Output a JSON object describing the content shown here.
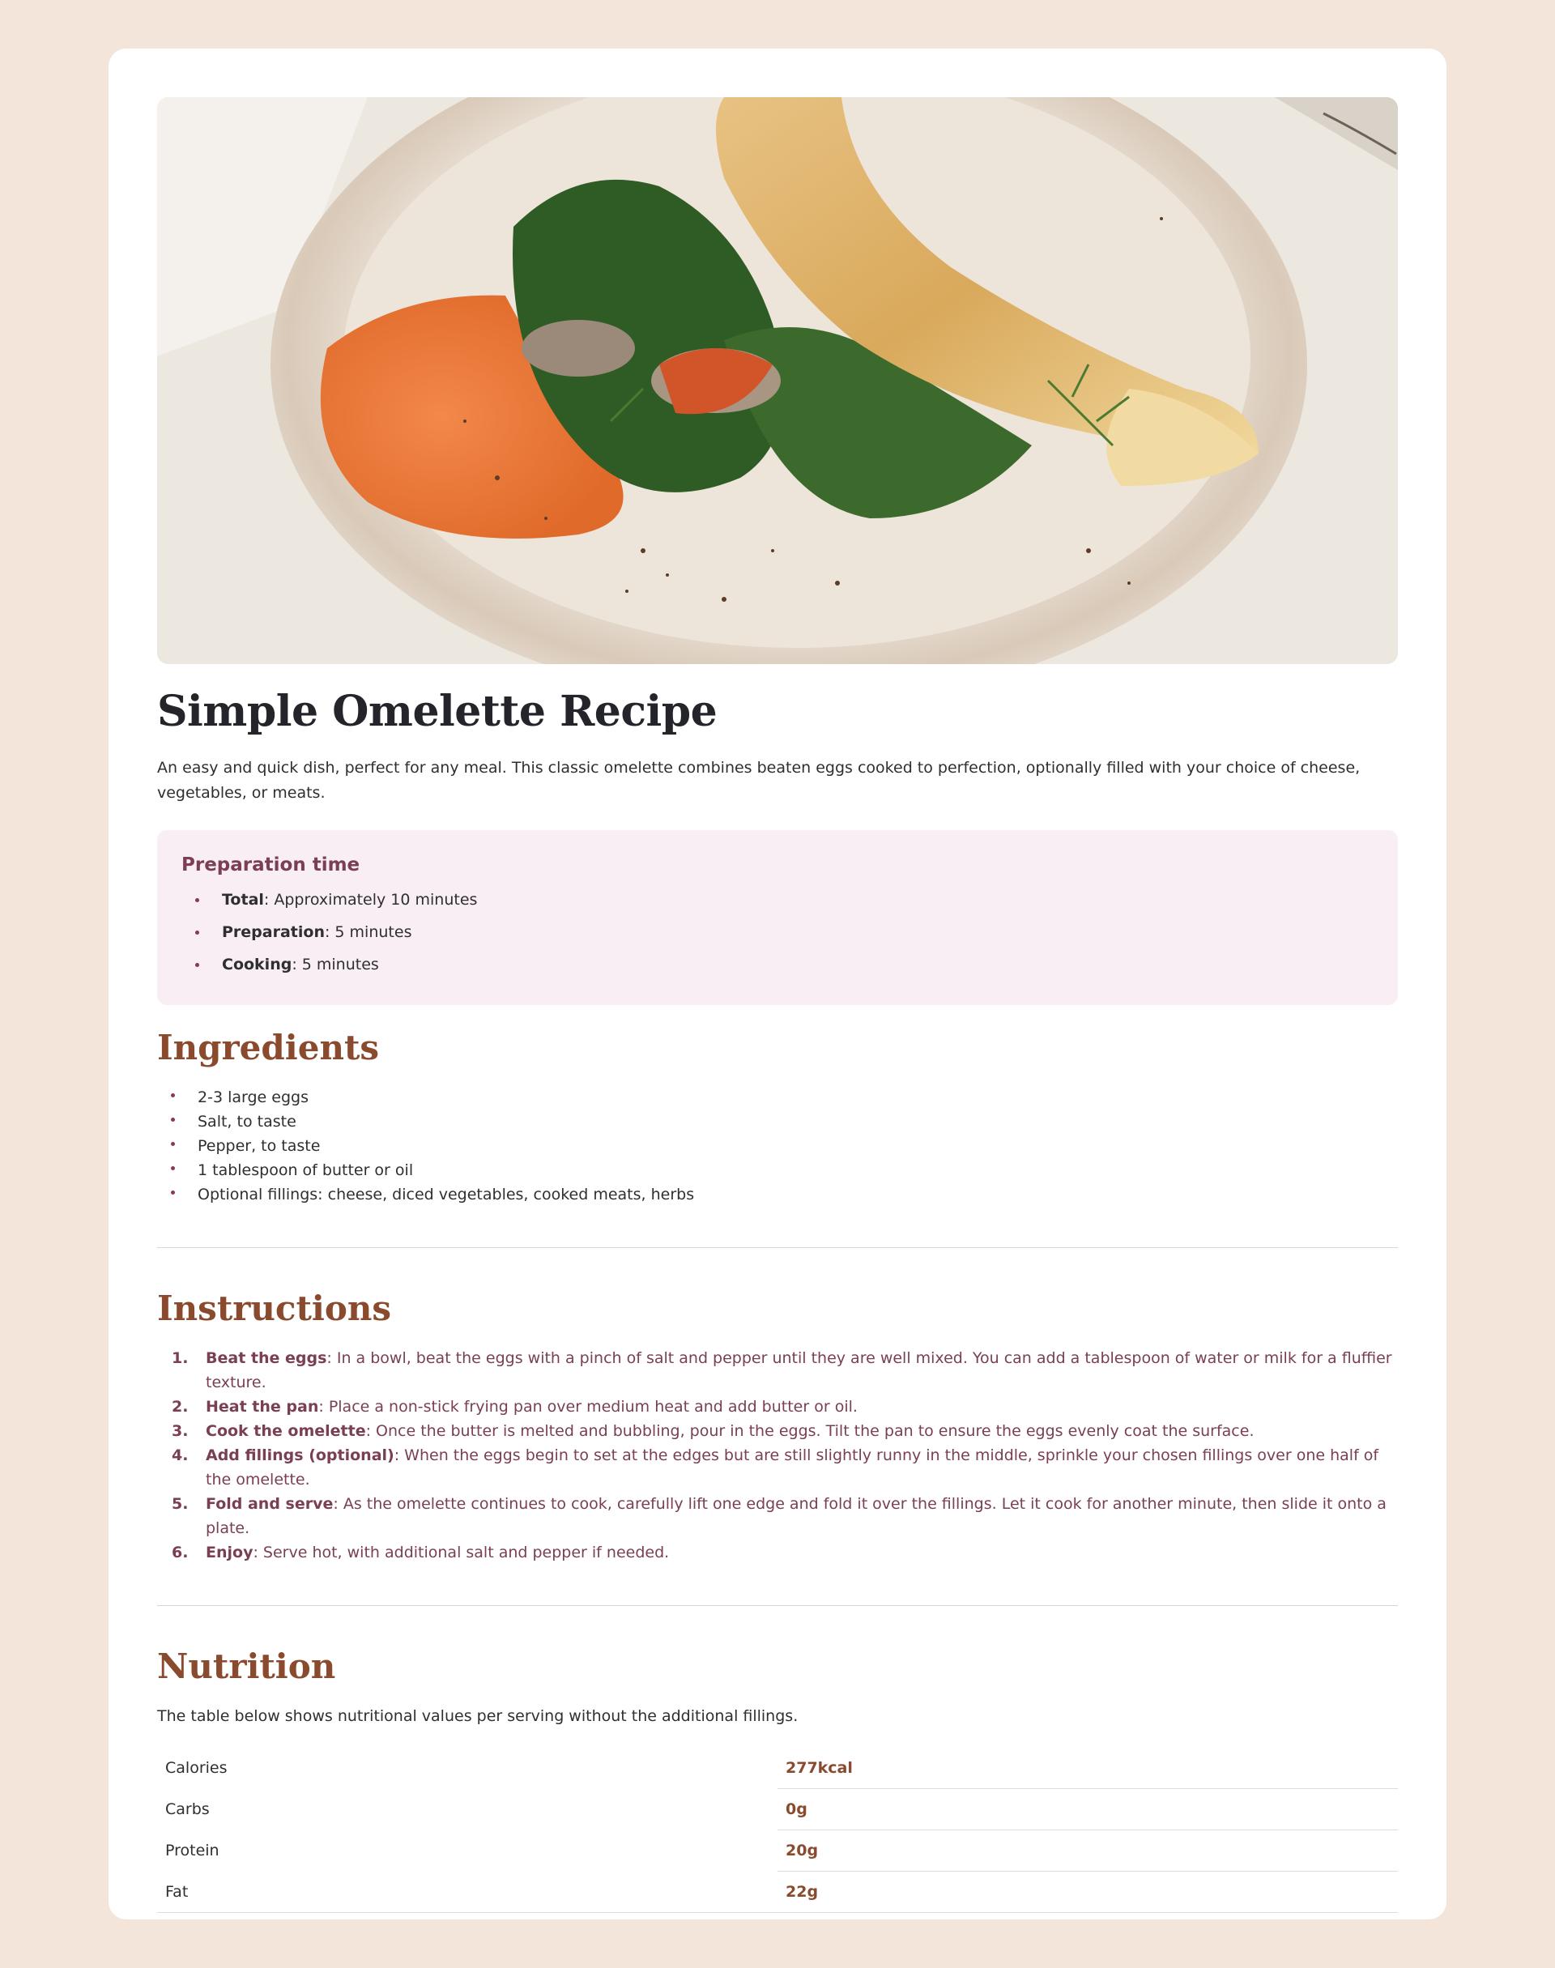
{
  "recipe": {
    "title": "Simple Omelette Recipe",
    "intro": "An easy and quick dish, perfect for any meal. This classic omelette combines beaten eggs cooked to perfection, optionally filled with your choice of cheese, vegetables, or meats.",
    "image_alt": "Omelette with spinach, mushrooms and orange spread on a plate"
  },
  "prep": {
    "heading": "Preparation time",
    "items": [
      {
        "label": "Total",
        "text": ": Approximately 10 minutes"
      },
      {
        "label": "Preparation",
        "text": ": 5 minutes"
      },
      {
        "label": "Cooking",
        "text": ": 5 minutes"
      }
    ]
  },
  "ingredients": {
    "heading": "Ingredients",
    "items": [
      "2-3 large eggs",
      "Salt, to taste",
      "Pepper, to taste",
      "1 tablespoon of butter or oil",
      "Optional fillings: cheese, diced vegetables, cooked meats, herbs"
    ]
  },
  "instructions": {
    "heading": "Instructions",
    "steps": [
      {
        "label": "Beat the eggs",
        "text": ": In a bowl, beat the eggs with a pinch of salt and pepper until they are well mixed. You can add a tablespoon of water or milk for a fluffier texture."
      },
      {
        "label": "Heat the pan",
        "text": ": Place a non-stick frying pan over medium heat and add butter or oil."
      },
      {
        "label": "Cook the omelette",
        "text": ": Once the butter is melted and bubbling, pour in the eggs. Tilt the pan to ensure the eggs evenly coat the surface."
      },
      {
        "label": "Add fillings (optional)",
        "text": ": When the eggs begin to set at the edges but are still slightly runny in the middle, sprinkle your chosen fillings over one half of the omelette."
      },
      {
        "label": "Fold and serve",
        "text": ": As the omelette continues to cook, carefully lift one edge and fold it over the fillings. Let it cook for another minute, then slide it onto a plate."
      },
      {
        "label": "Enjoy",
        "text": ": Serve hot, with additional salt and pepper if needed."
      }
    ]
  },
  "nutrition": {
    "heading": "Nutrition",
    "intro": "The table below shows nutritional values per serving without the additional fillings.",
    "rows": [
      {
        "name": "Calories",
        "value": "277kcal"
      },
      {
        "name": "Carbs",
        "value": "0g"
      },
      {
        "name": "Protein",
        "value": "20g"
      },
      {
        "name": "Fat",
        "value": "22g"
      }
    ]
  },
  "colors": {
    "page_bg": "#f3e5d9",
    "card_bg": "#ffffff",
    "accent_brown": "#8a4a2e",
    "accent_plum": "#7a3e55",
    "prep_bg": "#f8eef4"
  }
}
